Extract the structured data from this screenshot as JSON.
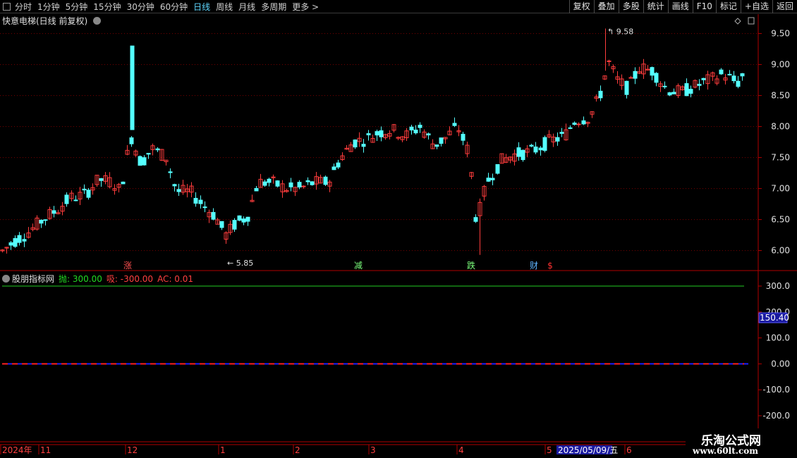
{
  "toolbar": {
    "periods": [
      "分时",
      "1分钟",
      "5分钟",
      "15分钟",
      "30分钟",
      "60分钟",
      "日线",
      "周线",
      "月线",
      "多周期",
      "更多 >"
    ],
    "active_period": "日线",
    "buttons": [
      "复权",
      "叠加",
      "多股",
      "统计",
      "画线",
      "F10",
      "标记",
      "+自选",
      "返回"
    ]
  },
  "main_chart": {
    "title": "快意电梯(日线 前复权)",
    "y_ticks": [
      "9.50",
      "9.00",
      "8.50",
      "8.00",
      "7.50",
      "7.00",
      "6.50",
      "6.00"
    ],
    "high_label": "9.58",
    "low_label": "5.85",
    "event_markers": [
      {
        "text": "涨",
        "color": "#ff5050"
      },
      {
        "text": "减",
        "color": "#7cff7c"
      },
      {
        "text": "跌",
        "color": "#7cff7c"
      },
      {
        "text": "财",
        "color": "#5fb4ff"
      },
      {
        "text": "$",
        "color": "#ff3030"
      }
    ]
  },
  "indicator": {
    "name": "股朋指标网",
    "fields": [
      {
        "label": "抛: 300.00",
        "color": "#22dd22"
      },
      {
        "label": "吸: -300.00",
        "color": "#ff4040"
      },
      {
        "label": "AC: 0.01",
        "color": "#ff4040"
      }
    ],
    "y_ticks": [
      "300.0",
      "200.0",
      "100.0",
      "0.00",
      "-100.0",
      "-200.0"
    ],
    "cursor_value": "150.40"
  },
  "time_axis": {
    "labels": [
      "2024年",
      "11",
      "12",
      "1",
      "2",
      "3",
      "4",
      "5",
      "6"
    ],
    "cursor_date": "2025/05/09/五"
  },
  "watermark": {
    "line1": "乐淘公式网",
    "line2": "www.60lt.com"
  },
  "colors": {
    "up": "#ff3c3c",
    "down": "#54ffff",
    "grid": "#7a0000",
    "axis": "#b00000"
  },
  "chart_data": {
    "type": "candlestick",
    "title": "快意电梯(日线 前复权)",
    "ylim": [
      5.7,
      9.7
    ],
    "ohlc_sample": [
      [
        5.98,
        6.05,
        5.92,
        6.02
      ],
      [
        6.1,
        6.3,
        6.05,
        6.25
      ],
      [
        6.35,
        6.6,
        6.3,
        6.55
      ],
      [
        6.6,
        6.9,
        6.5,
        6.85
      ],
      [
        6.9,
        7.3,
        6.85,
        7.15
      ],
      [
        7.2,
        7.3,
        6.9,
        6.95
      ],
      [
        6.95,
        9.3,
        6.9,
        7.95
      ],
      [
        7.95,
        8.1,
        7.3,
        7.45
      ],
      [
        7.5,
        7.8,
        7.3,
        7.6
      ],
      [
        7.5,
        7.6,
        6.9,
        7.0
      ],
      [
        7.2,
        7.3,
        6.8,
        6.95
      ],
      [
        6.9,
        7.0,
        6.5,
        6.6
      ],
      [
        6.6,
        6.7,
        6.1,
        6.2
      ],
      [
        6.2,
        6.4,
        5.85,
        6.35
      ],
      [
        6.4,
        7.0,
        6.3,
        6.95
      ],
      [
        7.1,
        7.3,
        6.9,
        7.0
      ],
      [
        7.0,
        7.1,
        6.9,
        7.05
      ],
      [
        7.1,
        7.3,
        6.9,
        7.2
      ],
      [
        7.2,
        8.0,
        7.1,
        7.9
      ],
      [
        7.9,
        8.3,
        7.5,
        7.7
      ],
      [
        7.9,
        8.4,
        7.8,
        8.0
      ],
      [
        8.0,
        8.05,
        7.8,
        7.9
      ],
      [
        7.95,
        8.1,
        7.8,
        8.0
      ],
      [
        8.0,
        8.3,
        7.4,
        7.6
      ],
      [
        7.3,
        7.5,
        6.4,
        6.6
      ],
      [
        6.8,
        7.2,
        5.9,
        7.1
      ],
      [
        7.1,
        7.7,
        7.0,
        7.6
      ],
      [
        7.6,
        8.0,
        7.5,
        7.8
      ],
      [
        7.8,
        8.0,
        7.7,
        7.95
      ],
      [
        8.0,
        8.6,
        7.9,
        8.5
      ],
      [
        8.5,
        9.58,
        8.4,
        9.0
      ],
      [
        9.0,
        9.2,
        8.4,
        8.6
      ],
      [
        8.6,
        9.1,
        8.5,
        9.0
      ],
      [
        8.9,
        9.1,
        8.6,
        8.75
      ],
      [
        8.7,
        8.9,
        8.2,
        8.4
      ],
      [
        8.5,
        8.8,
        8.4,
        8.75
      ],
      [
        8.8,
        9.0,
        8.6,
        8.85
      ],
      [
        8.7,
        9.05,
        8.6,
        8.95
      ]
    ],
    "indicator_series": [
      {
        "name": "抛",
        "value": 300.0
      },
      {
        "name": "吸",
        "value": -300.0
      },
      {
        "name": "AC",
        "value": 0.01
      }
    ]
  }
}
